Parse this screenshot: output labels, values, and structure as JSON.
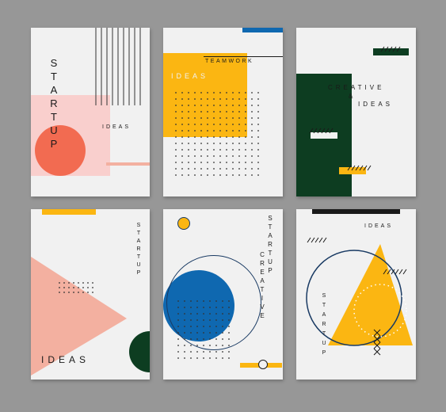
{
  "colors": {
    "background": "#979797",
    "card": "#f1f1f1",
    "coral": "#f26b51",
    "pink": "#f9cfcd",
    "salmon": "#f3b0a0",
    "yellow": "#fbb612",
    "green": "#0d3d21",
    "blue": "#0f68b0",
    "navy": "#193a63",
    "black": "#1a1a1a"
  },
  "posters": [
    {
      "vertical_word": "STARTUP",
      "label": "IDEAS"
    },
    {
      "label": "IDEAS",
      "tagline": "TEAMWORK"
    },
    {
      "line1": "CREATIVE",
      "amp": "&",
      "line2": "IDEAS"
    },
    {
      "vertical_word": "STARTUP",
      "label": "IDEAS"
    },
    {
      "vertical_word_1": "STARTUP",
      "vertical_word_2": "CREATIVE"
    },
    {
      "label": "IDEAS",
      "vertical_word": "STARTUP"
    }
  ]
}
